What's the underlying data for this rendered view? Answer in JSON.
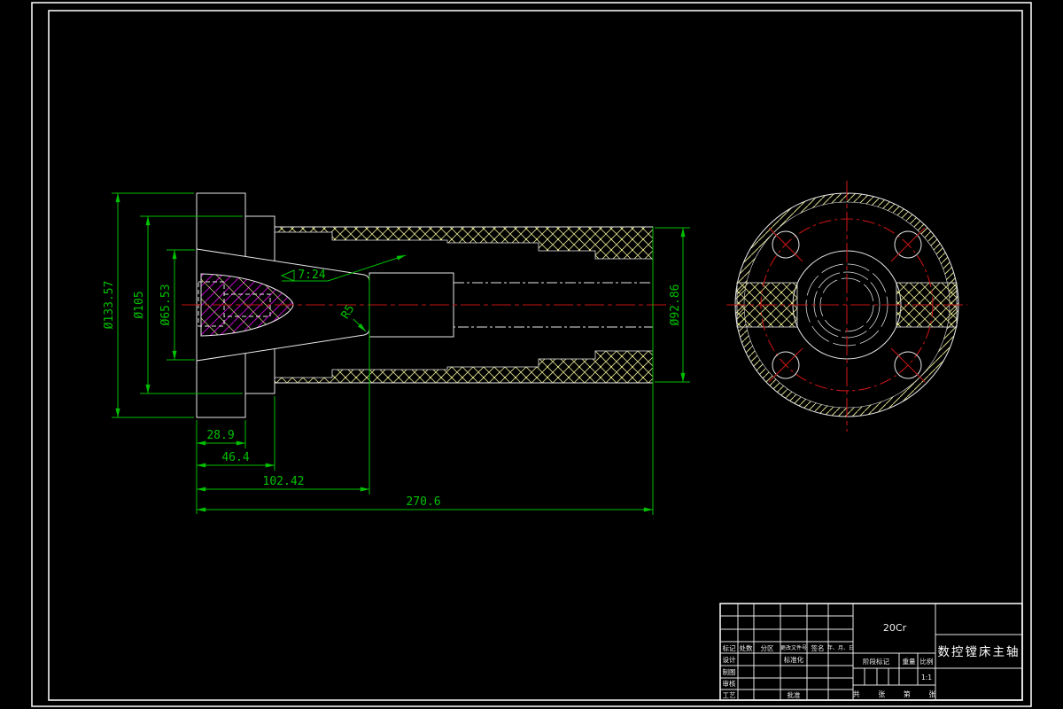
{
  "drawing": {
    "type": "CAD technical drawing, black model-space background",
    "colors": {
      "dimension_green": "#00c000",
      "centerline_red": "#c41414",
      "hatch_magenta": "#c000c8",
      "hatch_yellow": "#d6d68c",
      "line_white": "#e9e9e9"
    },
    "dimensions": {
      "dia_flange": "Ø133.57",
      "dia_step": "Ø105",
      "dia_bore": "Ø65.53",
      "taper": "7:24",
      "fillet": "R5",
      "dia_body": "Ø92.86",
      "len_28": "28.9",
      "len_46": "46.4",
      "len_102": "102.42",
      "len_270": "270.6"
    },
    "title_block": {
      "material": "20Cr",
      "part_name": "数控镗床主轴",
      "header_cells": [
        "标记",
        "处数",
        "分区",
        "更改文件号",
        "签名",
        "年、月、日"
      ],
      "row_labels": [
        "设计",
        "制图",
        "审核",
        "工艺"
      ],
      "standardization": "标准化",
      "approval": "批准",
      "stage_mark": "阶段标记",
      "weight_label": "重量",
      "scale_label": "比例",
      "scale_value": "1:1",
      "sheet_info": "共 张 第 张"
    }
  }
}
